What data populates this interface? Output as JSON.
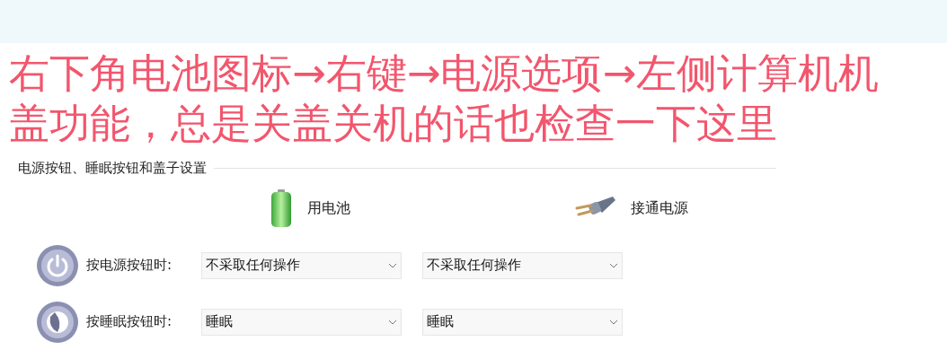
{
  "annotation": {
    "lines": [
      "右下角电池图标→右键→电源选项→左侧计算机机",
      "盖功能，总是关盖关机的话也检查一下这里"
    ]
  },
  "section": {
    "title": "电源按钮、睡眠按钮和盖子设置",
    "columns": [
      {
        "label": "用电池",
        "kind": "battery"
      },
      {
        "label": "接通电源",
        "kind": "plug"
      }
    ],
    "rows": [
      {
        "label": "按电源按钮时:",
        "kind": "power",
        "values": [
          "不采取任何操作",
          "不采取任何操作"
        ]
      },
      {
        "label": "按睡眠按钮时:",
        "kind": "sleep",
        "values": [
          "睡眠",
          "睡眠"
        ]
      }
    ]
  }
}
